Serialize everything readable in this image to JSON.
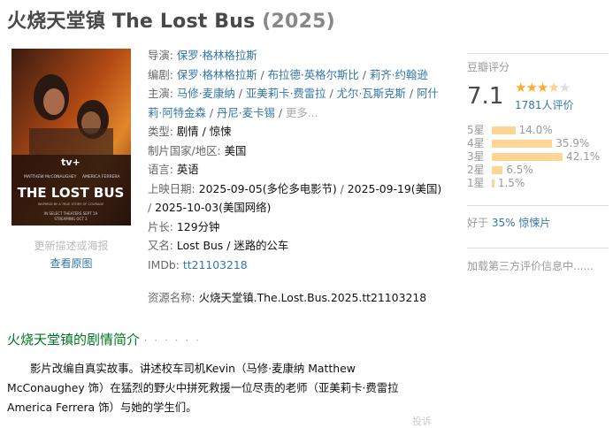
{
  "title": {
    "name": "火烧天堂镇 The Lost Bus",
    "year": "(2025)"
  },
  "poster": {
    "brand": "tv+",
    "cast_left": "MATTHEW McCONAUGHEY",
    "cast_right": "AMERICA FERRERA",
    "movie_title": "THE LOST BUS",
    "tagline": "INSPIRED BY A TRUE STORY OF COURAGE",
    "release_line1": "IN SELECT THEATERS SEPT 19",
    "release_line2": "STREAMING OCT 3"
  },
  "poster_links": {
    "update": "更新描述或海报",
    "view": "查看原图"
  },
  "info": {
    "director_label": "导演:",
    "director": "保罗·格林格拉斯",
    "writer_label": "编剧:",
    "writers": [
      "保罗·格林格拉斯",
      "布拉德·英格尔斯比",
      "莉齐·约翰逊"
    ],
    "cast_label": "主演:",
    "cast": [
      "马修·麦康纳",
      "亚美莉卡·费雷拉",
      "尤尔·瓦斯克斯",
      "阿什莉·阿特金森",
      "丹尼·麦卡锡"
    ],
    "cast_more": "更多...",
    "sep": " / ",
    "genre_label": "类型:",
    "genre": "剧情 / 惊悚",
    "country_label": "制片国家/地区:",
    "country": "美国",
    "language_label": "语言:",
    "language": "英语",
    "release_label": "上映日期:",
    "release_a": "2025-09-05(多伦多电影节)",
    "release_b": "2025-09-19(美国)",
    "release_c": "2025-10-03(美国网络)",
    "runtime_label": "片长:",
    "runtime": "129分钟",
    "aka_label": "又名:",
    "aka": "Lost Bus / 迷路的公车",
    "imdb_label": "IMDb:",
    "imdb": "tt21103218"
  },
  "resource": {
    "label": "资源名称:",
    "value": "火烧天堂镇.The.Lost.Bus.2025.tt21103218"
  },
  "rating": {
    "label": "豆瓣评分",
    "score": "7.1",
    "stars_full": "★★★",
    "stars_half": "★",
    "stars_empty": "★",
    "count": "1781人评价",
    "breakdown": [
      {
        "label": "5星",
        "pct": "14.0%",
        "value": 14.0
      },
      {
        "label": "4星",
        "pct": "35.9%",
        "value": 35.9
      },
      {
        "label": "3星",
        "pct": "42.1%",
        "value": 42.1
      },
      {
        "label": "2星",
        "pct": "6.5%",
        "value": 6.5
      },
      {
        "label": "1星",
        "pct": "1.5%",
        "value": 1.5
      }
    ],
    "better_prefix": "好于",
    "better_pct": "35%",
    "better_link": "惊悚片",
    "third_party": "加载第三方评价信息中......"
  },
  "summary": {
    "heading": "火烧天堂镇的剧情简介",
    "dots": "· · · · · ·",
    "text": "影片改编自真实故事。讲述校车司机Kevin（马修·麦康纳 Matthew McConaughey 饰）在猛烈的野火中拼死救援一位尽责的老师（亚美莉卡·费雷拉 America Ferrera 饰）与她的学生们。",
    "report": "投诉"
  },
  "colors": {
    "link": "#3377aa",
    "green": "#007722",
    "star": "#ffac2d",
    "bar": "#ffd596"
  }
}
